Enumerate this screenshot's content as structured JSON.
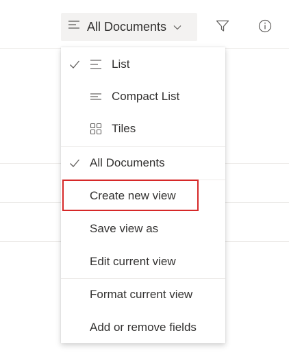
{
  "toolbar": {
    "view_label": "All Documents",
    "icons": {
      "view": "list-lines-icon",
      "chevron": "chevron-down-icon",
      "filter": "filter-icon",
      "info": "info-icon"
    }
  },
  "menu": {
    "layout": {
      "list": "List",
      "compact_list": "Compact List",
      "tiles": "Tiles",
      "selected": "List"
    },
    "views": {
      "all_documents": "All Documents",
      "selected": "All Documents"
    },
    "actions": {
      "create_new_view": "Create new view",
      "save_view_as": "Save view as",
      "edit_current_view": "Edit current view"
    },
    "format": {
      "format_current_view": "Format current view",
      "add_or_remove_fields": "Add or remove fields"
    }
  },
  "annotation": {
    "highlight_color": "#d62828",
    "highlighted_item": "Create new view"
  }
}
